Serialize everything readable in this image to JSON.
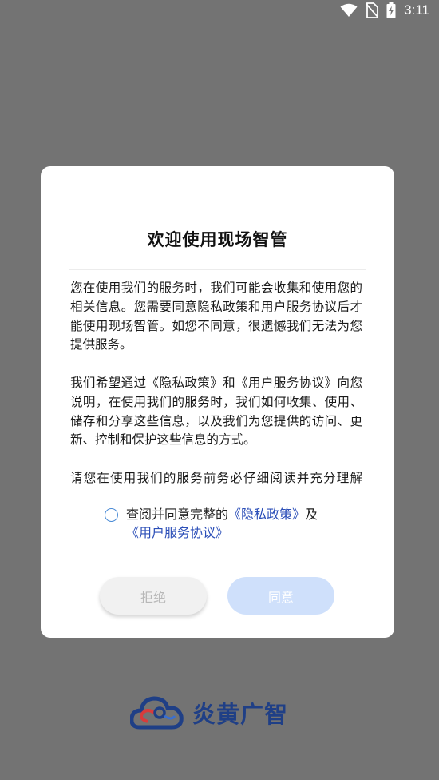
{
  "status_bar": {
    "time": "3:11",
    "icons": [
      "wifi-icon",
      "no-sim-icon",
      "battery-charging-icon"
    ]
  },
  "dialog": {
    "title": "欢迎使用现场智管",
    "paragraphs": [
      "您在使用我们的服务时，我们可能会收集和使用您的相关信息。您需要同意隐私政策和用户服务协议后才能使用现场智管。如您不同意，很遗憾我们无法为您提供服务。",
      "我们希望通过《隐私政策》和《用户服务协议》向您说明，在使用我们的服务时，我们如何收集、使用、储存和分享这些信息，以及我们为您提供的访问、更新、控制和保护这些信息的方式。",
      "请您在使用我们的服务前务必仔细阅读并充分理解《隐私政策》和《用户服务协议》，如您同"
    ],
    "consent": {
      "prefix": "查阅并同意完整的",
      "privacy_link": "《隐私政策》",
      "joiner": "及",
      "terms_link": "《用户服务协议》",
      "checked": false
    },
    "reject_label": "拒绝",
    "agree_label": "同意"
  },
  "brand": {
    "name": "炎黄广智",
    "logo_icon": "cloud-logo-icon"
  },
  "colors": {
    "overlay": "#737373",
    "link": "#2c4fb8",
    "radio": "#4a8bd6",
    "agree_button": "#cfe0fb",
    "brand": "#1f3f86"
  }
}
